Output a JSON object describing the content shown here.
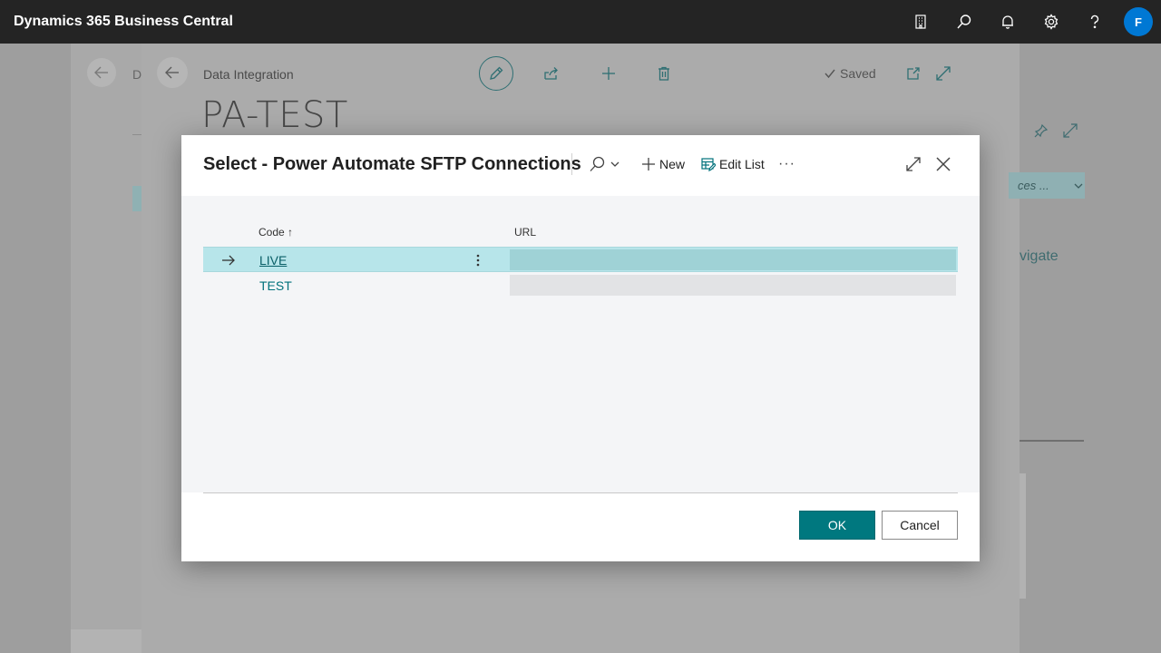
{
  "app": {
    "title": "Dynamics 365 Business Central",
    "user_initial": "F",
    "icons": [
      "company-icon",
      "search-icon",
      "bell-icon",
      "gear-icon",
      "help-icon"
    ]
  },
  "background": {
    "page1_crumb_letter": "D",
    "breadcrumb": "Data Integration",
    "page_title": "PA-TEST",
    "saved_label": "Saved",
    "right_pill_text": "ces ...",
    "right_link_text": "vigate"
  },
  "dialog": {
    "title": "Select - Power Automate SFTP Connections",
    "actions": {
      "new_label": "New",
      "edit_list_label": "Edit List",
      "more_label": "···"
    },
    "columns": {
      "code": "Code",
      "code_sort": "↑",
      "url": "URL"
    },
    "rows": [
      {
        "code": "LIVE",
        "url": "",
        "selected": true
      },
      {
        "code": "TEST",
        "url": "",
        "selected": false
      }
    ],
    "ok_label": "OK",
    "cancel_label": "Cancel"
  },
  "colors": {
    "appbar": "#242424",
    "accent": "#00787f",
    "avatar": "#0078d4",
    "selected_row": "#b7e5ea"
  }
}
